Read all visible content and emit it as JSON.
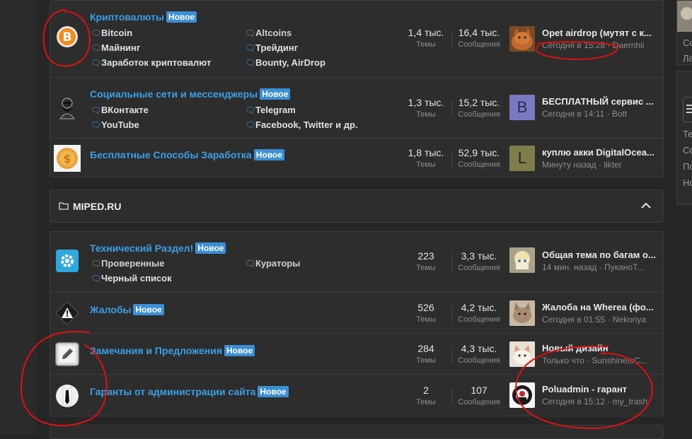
{
  "sections": {
    "top": {
      "forums": [
        {
          "title": "Криптовалюты",
          "badge": "Новое",
          "subs": [
            "Bitcoin",
            "Altcoins",
            "Майнинг",
            "Трейдинг",
            "Заработок криптовалют",
            "Bounty, AirDrop"
          ],
          "threads": "1,4 тыс.",
          "threads_label": "Темы",
          "messages": "16,4 тыс.",
          "messages_label": "Сообщения",
          "last_title": "Opet airdrop (мутят с к...",
          "last_time": "Сегодня в 15:28",
          "last_user": "Daernhii"
        },
        {
          "title": "Социальные сети и мессенджеры",
          "badge": "Новое",
          "subs": [
            "ВКонтакте",
            "Telegram",
            "YouTube",
            "Facebook, Twitter и др."
          ],
          "threads": "1,3 тыс.",
          "threads_label": "Темы",
          "messages": "15,2 тыс.",
          "messages_label": "Сообщения",
          "last_title": "БЕСПЛАТНЫЙ сервис ...",
          "last_time": "Сегодня в 14:11",
          "last_user": "Bott",
          "avatar_letter": "B"
        },
        {
          "title": "Бесплатные Способы Заработка",
          "badge": "Новое",
          "subs": [],
          "threads": "1,8 тыс.",
          "threads_label": "Темы",
          "messages": "52,9 тыс.",
          "messages_label": "Сообщения",
          "last_title": "куплю акки DigitalOcea...",
          "last_time": "Минуту назад",
          "last_user": "likter",
          "avatar_letter": "L"
        }
      ]
    },
    "miped": {
      "category_title": "MIPED.RU",
      "forums": [
        {
          "title": "Технический Раздел!",
          "badge": "Новое",
          "subs": [
            "Проверенные",
            "Кураторы",
            "Черный список"
          ],
          "threads": "223",
          "threads_label": "Темы",
          "messages": "3,3 тыс.",
          "messages_label": "Сообщения",
          "last_title": "Общая тема по багам о...",
          "last_time": "14 мин. назад",
          "last_user": "ПуканоТ..."
        },
        {
          "title": "Жалобы",
          "badge": "Новое",
          "subs": [],
          "threads": "526",
          "threads_label": "Темы",
          "messages": "4,2 тыс.",
          "messages_label": "Сообщения",
          "last_title": "Жалоба на Wherea (фо...",
          "last_time": "Сегодня в 01:55",
          "last_user": "Nekonya"
        },
        {
          "title": "Замечания и Предложения",
          "badge": "Новое",
          "subs": [],
          "threads": "284",
          "threads_label": "Темы",
          "messages": "4,3 тыс.",
          "messages_label": "Сообщения",
          "last_title": "Новый дизайн",
          "last_time": "Только что",
          "last_user": "SunshineIsC..."
        },
        {
          "title": "Гаранты от администрации сайта",
          "badge": "Новое",
          "subs": [],
          "threads": "2",
          "threads_label": "Темы",
          "messages": "107",
          "messages_label": "Сообщения",
          "last_title": "Poluadmin - гарант",
          "last_time": "Сегодня в 15:12",
          "last_user": "my_trash"
        }
      ]
    }
  },
  "right_sidebar": {
    "snips": [
      "Co",
      "Ла",
      "Те",
      "Co",
      "По",
      "Но"
    ]
  },
  "colors": {
    "accent": "#3aa0e6",
    "badge": "#3b8fd4",
    "annotation": "#e01010"
  }
}
